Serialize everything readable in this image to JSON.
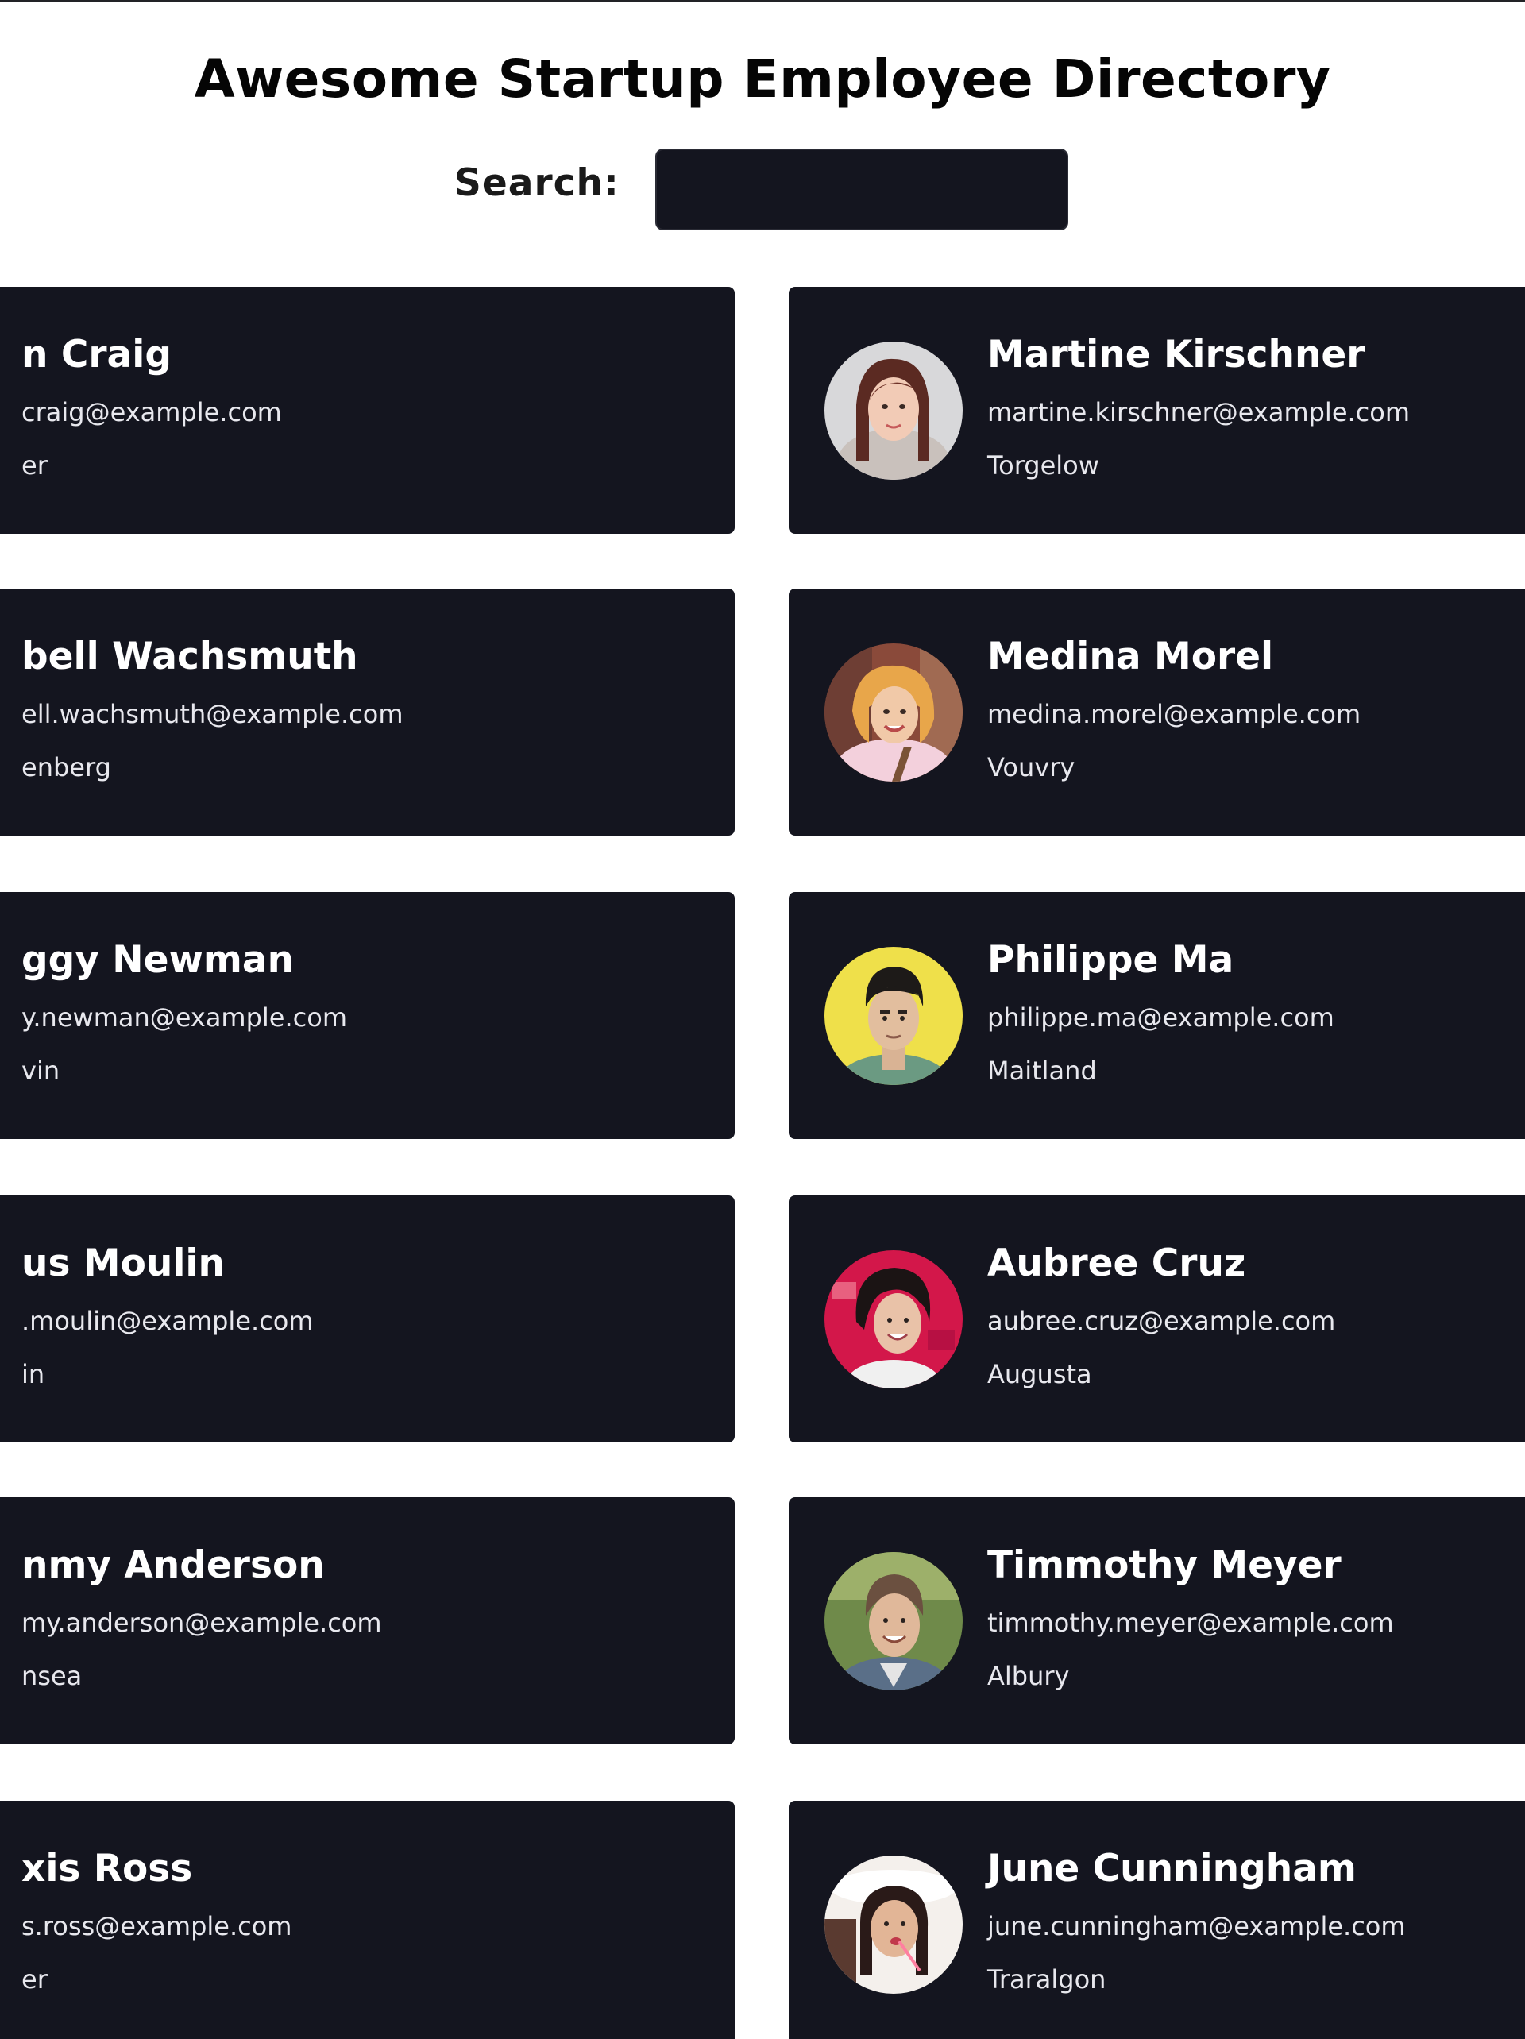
{
  "page": {
    "title": "Awesome Startup Employee Directory"
  },
  "search": {
    "label": "Search:",
    "value": "",
    "placeholder": ""
  },
  "colors": {
    "card_background": "#14151f",
    "page_background": "#ffffff",
    "card_text": "#ffffff"
  },
  "left_column": [
    {
      "name": "n Craig",
      "email": "craig@example.com",
      "city": "er"
    },
    {
      "name": "bell Wachsmuth",
      "email": "ell.wachsmuth@example.com",
      "city": "enberg"
    },
    {
      "name": "ggy Newman",
      "email": "y.newman@example.com",
      "city": "vin"
    },
    {
      "name": "us Moulin",
      "email": ".moulin@example.com",
      "city": "in"
    },
    {
      "name": "nmy Anderson",
      "email": "my.anderson@example.com",
      "city": "nsea"
    },
    {
      "name": "xis Ross",
      "email": "s.ross@example.com",
      "city": "er"
    }
  ],
  "right_column": [
    {
      "name": "Martine Kirschner",
      "email": "martine.kirschner@example.com",
      "city": "Torgelow",
      "avatar": "portrait-photo"
    },
    {
      "name": "Medina Morel",
      "email": "medina.morel@example.com",
      "city": "Vouvry",
      "avatar": "portrait-photo"
    },
    {
      "name": "Philippe Ma",
      "email": "philippe.ma@example.com",
      "city": "Maitland",
      "avatar": "portrait-photo"
    },
    {
      "name": "Aubree Cruz",
      "email": "aubree.cruz@example.com",
      "city": "Augusta",
      "avatar": "portrait-photo"
    },
    {
      "name": "Timmothy Meyer",
      "email": "timmothy.meyer@example.com",
      "city": "Albury",
      "avatar": "portrait-photo"
    },
    {
      "name": "June Cunningham",
      "email": "june.cunningham@example.com",
      "city": "Traralgon",
      "avatar": "portrait-photo"
    }
  ]
}
